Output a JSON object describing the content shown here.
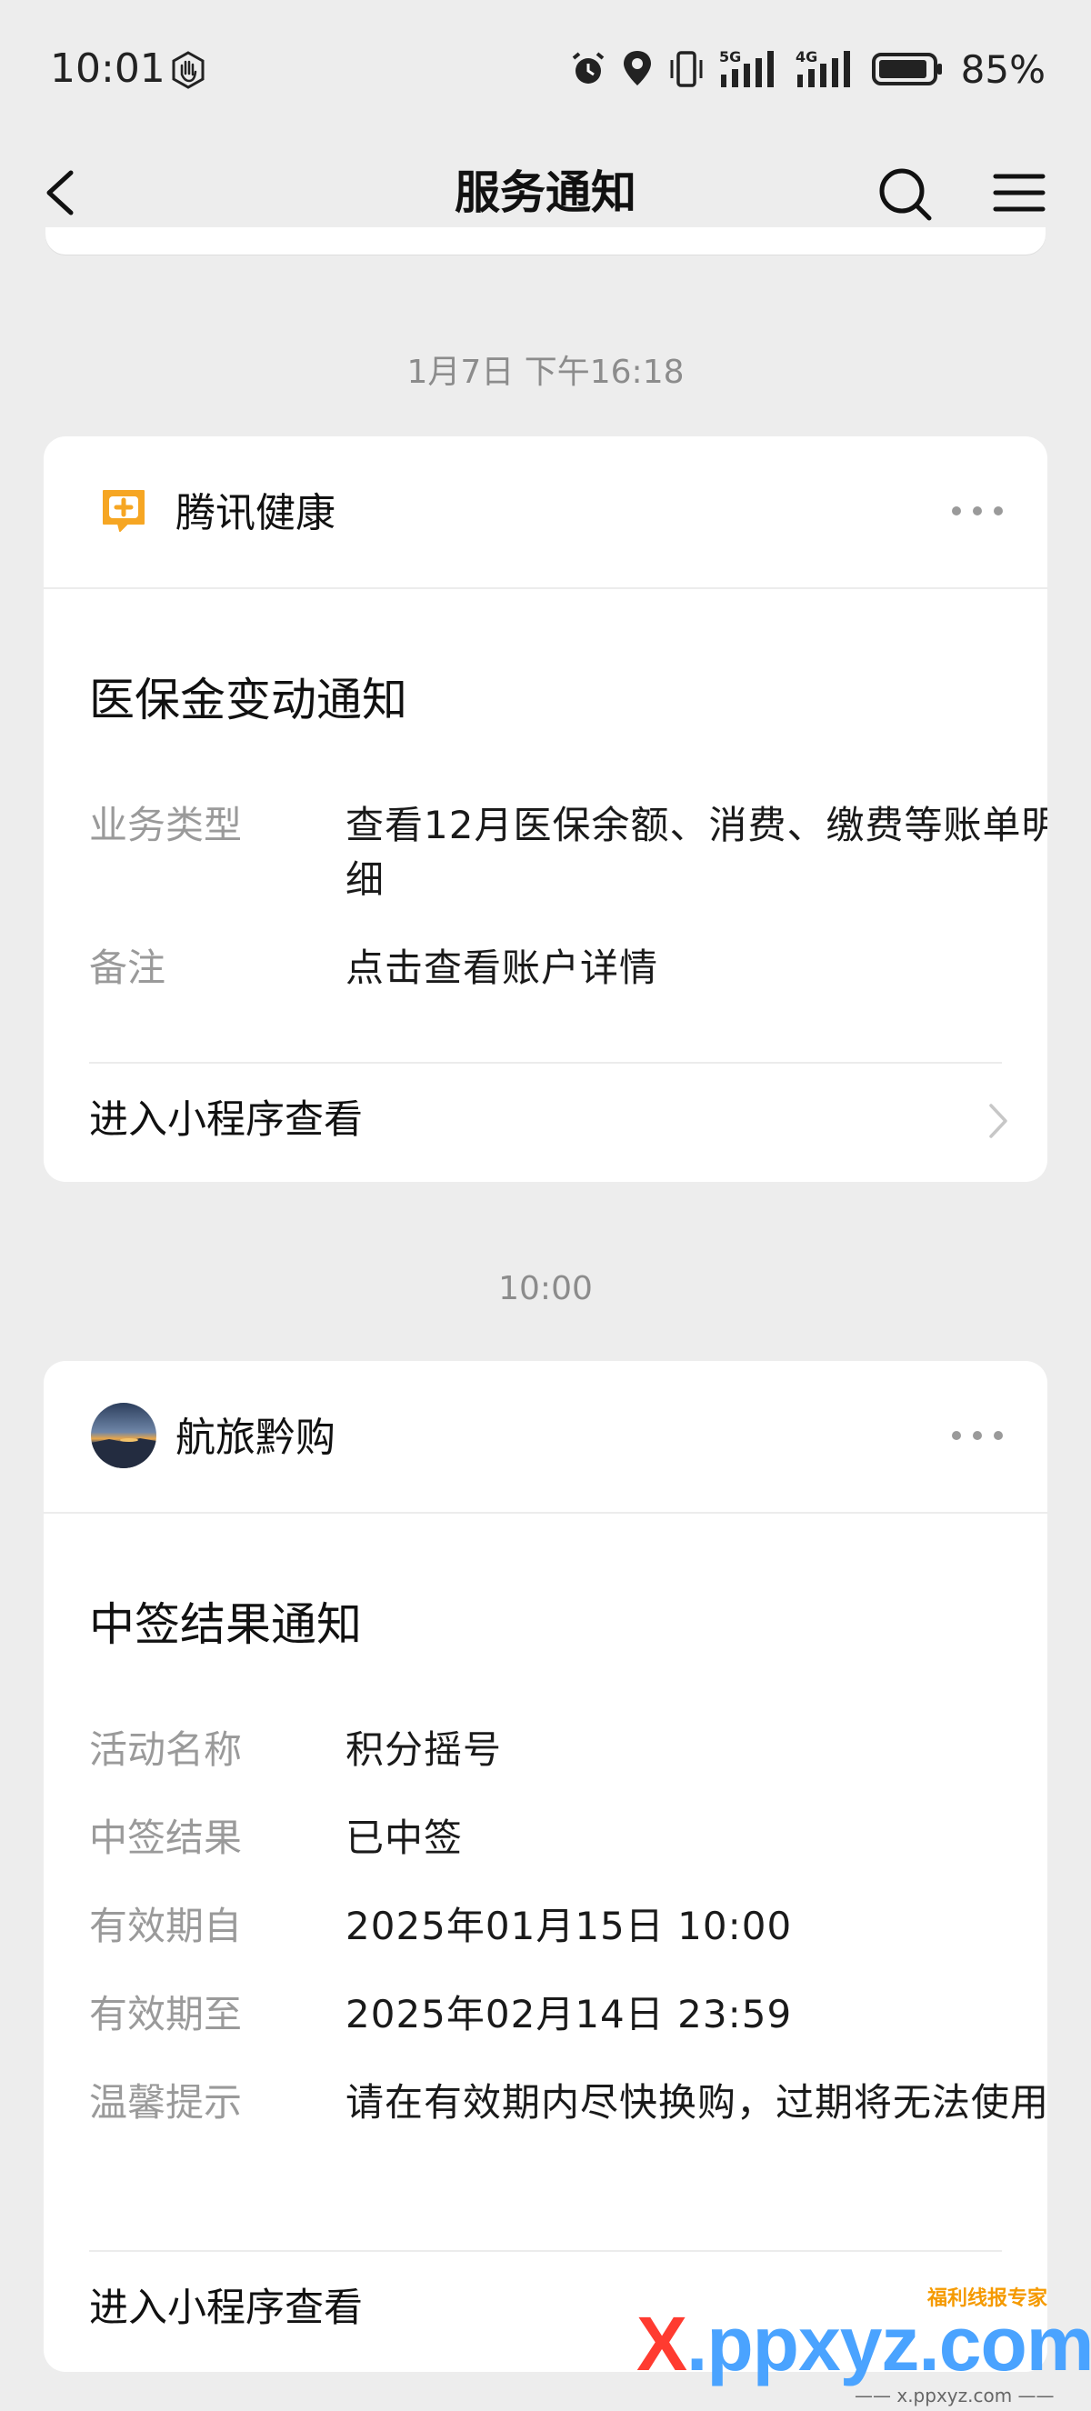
{
  "status_bar": {
    "time": "10:01",
    "battery_percent": "85%",
    "icons": [
      "hand-icon",
      "alarm-icon",
      "location-icon",
      "vibrate-icon",
      "5g-signal-icon",
      "4g-signal-icon",
      "battery-icon"
    ],
    "signal_labels": {
      "first": "5G",
      "second": "4G"
    }
  },
  "nav": {
    "title": "服务通知"
  },
  "timestamps": {
    "first": "1月7日 下午16:18",
    "second": "10:00"
  },
  "cards": [
    {
      "app_name": "腾讯健康",
      "icon": "health-plus-icon",
      "icon_color": "#f0a020",
      "title": "医保金变动通知",
      "fields": [
        {
          "label": "业务类型",
          "value": "查看12月医保余额、消费、缴费等账单明细"
        },
        {
          "label": "备注",
          "value": "点击查看账户详情"
        }
      ],
      "footer": "进入小程序查看"
    },
    {
      "app_name": "航旅黔购",
      "icon": "avatar-landscape",
      "title": "中签结果通知",
      "fields": [
        {
          "label": "活动名称",
          "value": "积分摇号"
        },
        {
          "label": "中签结果",
          "value": "已中签"
        },
        {
          "label": "有效期自",
          "value": "2025年01月15日 10:00"
        },
        {
          "label": "有效期至",
          "value": "2025年02月14日 23:59"
        },
        {
          "label": "温馨提示",
          "value": "请在有效期内尽快换购，过期将无法使用"
        }
      ],
      "footer": "进入小程序查看"
    }
  ],
  "watermark": {
    "main_x": "X",
    "main_rest": ".ppxyz.com",
    "badge": "福利线报专家",
    "small": "—— x.ppxyz.com ——"
  }
}
